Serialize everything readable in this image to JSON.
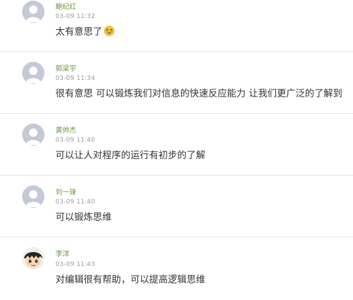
{
  "comments": [
    {
      "author": "鲍纪红",
      "time": "03-09 11:32",
      "text": "太有意思了",
      "emoji": "grinning-squinting-face-emoji",
      "avatar": "default-avatar"
    },
    {
      "author": "郭梁宇",
      "time": "03-09 11:34",
      "text": "很有意思 可以锻炼我们对信息的快速反应能力 让我们更广泛的了解到",
      "avatar": "default-avatar"
    },
    {
      "author": "黄帅杰",
      "time": "03-09 11:40",
      "text": "可以让人对程序的运行有初步的了解",
      "avatar": "default-avatar"
    },
    {
      "author": "刘一锋",
      "time": "03-09 11:40",
      "text": "可以锻炼思维",
      "avatar": "default-avatar"
    },
    {
      "author": "李洋",
      "time": "03-09 11:43",
      "text": "对编辑很有帮助，可以提高逻辑思维",
      "avatar": "cartoon-boy-avatar"
    }
  ],
  "colors": {
    "author_name": "#6a9a3c",
    "timestamp": "#9a9a9a",
    "comment_text": "#333333",
    "divider": "#e8e8e8",
    "default_avatar_bg": "#c4c9d8"
  }
}
